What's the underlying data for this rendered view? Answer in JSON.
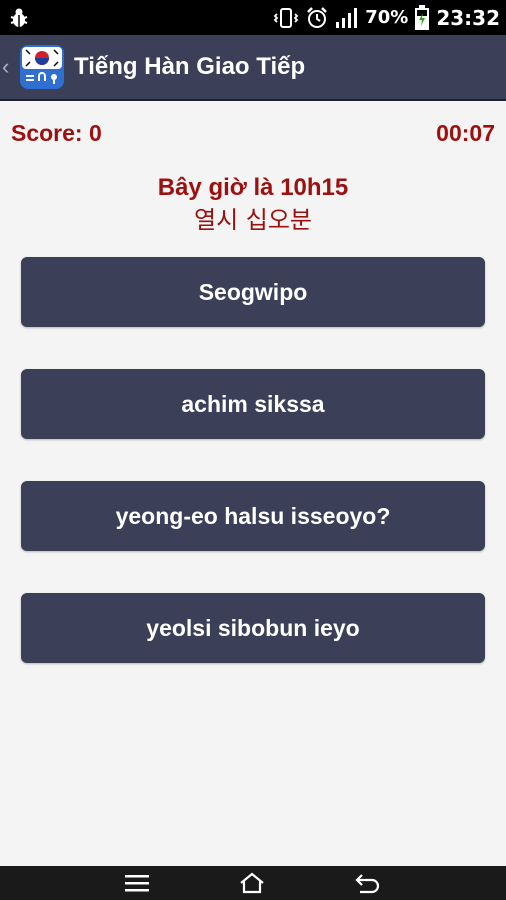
{
  "status_bar": {
    "battery_percent": "70%",
    "time": "23:32",
    "icons": [
      "bug-icon",
      "vibrate-icon",
      "alarm-icon",
      "signal-icon",
      "battery-charging-icon"
    ]
  },
  "app_bar": {
    "title": "Tiếng Hàn Giao Tiếp",
    "icons": [
      "chevron-left-icon",
      "app-logo-icon"
    ]
  },
  "game": {
    "score_label": "Score: 0",
    "timer": "00:07",
    "question_vi": "Bây giờ là 10h15",
    "question_ko": "열시 십오분"
  },
  "answers": [
    {
      "label": "Seogwipo"
    },
    {
      "label": "achim sikssa"
    },
    {
      "label": "yeong-eo halsu isseoyo?"
    },
    {
      "label": "yeolsi sibobun ieyo"
    }
  ],
  "nav_bar": {
    "icons": [
      "menu-icon",
      "home-icon",
      "back-icon"
    ]
  },
  "colors": {
    "accent": "#9c1010",
    "button_bg": "#3b3f58",
    "background": "#f4f4f4"
  }
}
